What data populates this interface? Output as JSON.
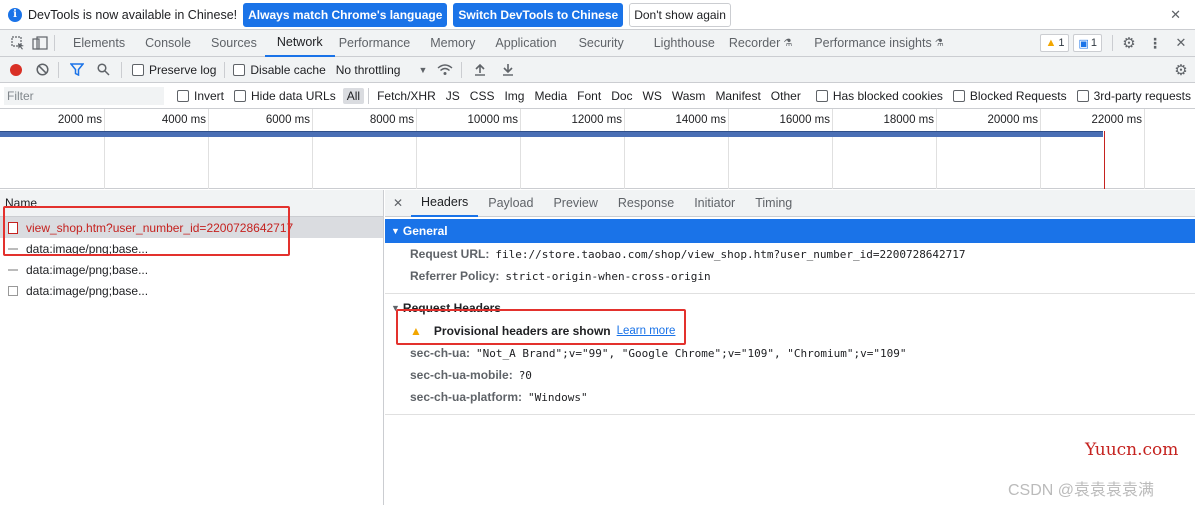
{
  "infobar": {
    "message": "DevTools is now available in Chinese!",
    "btn_match": "Always match Chrome's language",
    "btn_switch": "Switch DevTools to Chinese",
    "btn_dont_show": "Don't show again",
    "close": "✕"
  },
  "tabs": [
    "Elements",
    "Console",
    "Sources",
    "Network",
    "Performance",
    "Memory",
    "Application",
    "Security",
    "Lighthouse",
    "Recorder",
    "Performance insights"
  ],
  "active_tab": "Network",
  "badges": {
    "warnings": "1",
    "messages": "1"
  },
  "toolbar": {
    "preserve_log": "Preserve log",
    "disable_cache": "Disable cache",
    "throttling": "No throttling"
  },
  "filter": {
    "placeholder": "Filter",
    "invert": "Invert",
    "hide_data_urls": "Hide data URLs",
    "types": [
      "All",
      "Fetch/XHR",
      "JS",
      "CSS",
      "Img",
      "Media",
      "Font",
      "Doc",
      "WS",
      "Wasm",
      "Manifest",
      "Other"
    ],
    "has_blocked_cookies": "Has blocked cookies",
    "blocked_requests": "Blocked Requests",
    "third_party": "3rd-party requests"
  },
  "timeline": {
    "ticks": [
      "2000 ms",
      "4000 ms",
      "6000 ms",
      "8000 ms",
      "10000 ms",
      "12000 ms",
      "14000 ms",
      "16000 ms",
      "18000 ms",
      "20000 ms",
      "22000 ms"
    ]
  },
  "requests": {
    "column_name": "Name",
    "items": [
      "view_shop.htm?user_number_id=2200728642717",
      "data:image/png;base...",
      "data:image/png;base...",
      "data:image/png;base..."
    ]
  },
  "detail": {
    "tabs": [
      "Headers",
      "Payload",
      "Preview",
      "Response",
      "Initiator",
      "Timing"
    ],
    "general_title": "General",
    "request_url_label": "Request URL:",
    "request_url": "file://store.taobao.com/shop/view_shop.htm?user_number_id=2200728642717",
    "referrer_policy_label": "Referrer Policy:",
    "referrer_policy": "strict-origin-when-cross-origin",
    "request_headers_title": "Request Headers",
    "provisional_warning": "Provisional headers are shown",
    "learn_more": "Learn more",
    "headers": [
      {
        "key": "sec-ch-ua:",
        "value": "\"Not_A Brand\";v=\"99\", \"Google Chrome\";v=\"109\", \"Chromium\";v=\"109\""
      },
      {
        "key": "sec-ch-ua-mobile:",
        "value": "?0"
      },
      {
        "key": "sec-ch-ua-platform:",
        "value": "\"Windows\""
      }
    ]
  },
  "watermarks": {
    "site": "Yuucn.com",
    "csdn": "CSDN @袁袁袁袁满"
  }
}
